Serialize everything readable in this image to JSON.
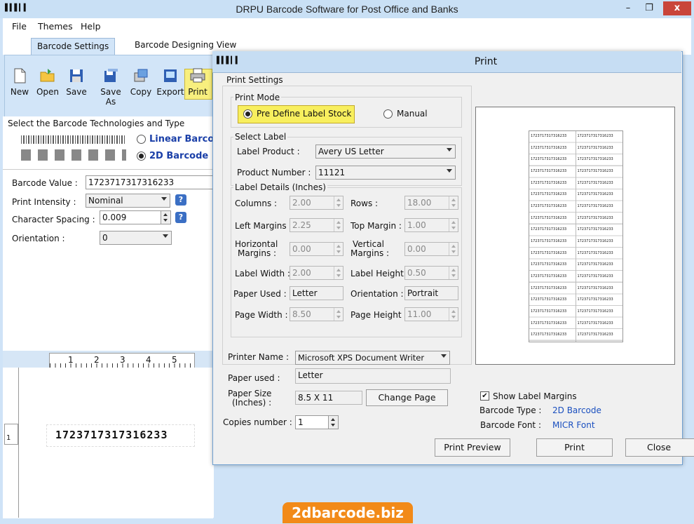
{
  "window": {
    "title": "DRPU Barcode Software for Post Office and Banks",
    "minimize": "–",
    "maximize": "❐",
    "close": "x"
  },
  "menu": [
    "File",
    "Themes",
    "Help"
  ],
  "tabs": [
    "Barcode Settings",
    "Barcode Designing View"
  ],
  "toolbar": {
    "new": "New",
    "open": "Open",
    "save": "Save",
    "save_as": "Save As",
    "copy": "Copy",
    "export": "Export",
    "print": "Print"
  },
  "left": {
    "tech_label": "Select the Barcode Technologies and Type",
    "linear": "Linear Barcod",
    "twod": "2D Barcode",
    "barcode_value_label": "Barcode Value :",
    "barcode_value": "1723717317316233",
    "print_intensity_label": "Print Intensity :",
    "print_intensity": "Nominal",
    "char_spacing_label": "Character Spacing :",
    "char_spacing": "0.009",
    "orientation_label": "Orientation :",
    "orientation": "0",
    "help": "?",
    "preview_text": "1723717317316233",
    "ruler_marks": [
      "1",
      "2",
      "3",
      "4",
      "5"
    ],
    "left_ruler_mark": "1"
  },
  "dialog": {
    "title": "Print",
    "print_settings": "Print Settings",
    "print_mode": "Print Mode",
    "predefine": "Pre Define Label Stock",
    "manual": "Manual",
    "select_label": "Select Label",
    "label_product_label": "Label Product :",
    "label_product": "Avery US Letter",
    "product_number_label": "Product Number :",
    "product_number": "11121",
    "label_details": "Label Details (Inches)",
    "columns_label": "Columns :",
    "columns": "2.00",
    "rows_label": "Rows :",
    "rows": "18.00",
    "left_margins_label": "Left Margins :",
    "left_margins": "2.25",
    "top_margin_label": "Top Margin :",
    "top_margin": "1.00",
    "h_margins_label1": "Horizontal",
    "h_margins_label2": "Margins :",
    "h_margins": "0.00",
    "v_margins_label1": "Vertical",
    "v_margins_label2": "Margins :",
    "v_margins": "0.00",
    "label_width_label": "Label Width :",
    "label_width": "2.00",
    "label_height_label": "Label Height :",
    "label_height": "0.50",
    "paper_used_label": "Paper Used :",
    "paper_used": "Letter",
    "orientation_label": "Orientation :",
    "orientation": "Portrait",
    "page_width_label": "Page Width :",
    "page_width": "8.50",
    "page_height_label": "Page Height :",
    "page_height": "11.00",
    "printer_name_label": "Printer Name :",
    "printer_name": "Microsoft XPS Document Writer",
    "paper_used2_label": "Paper used :",
    "paper_used2": "Letter",
    "paper_size_label1": "Paper Size",
    "paper_size_label2": "(Inches) :",
    "paper_size": "8.5 X 11",
    "change_page": "Change Page",
    "copies_label": "Copies number :",
    "copies": "1",
    "show_margins": "Show Label Margins",
    "barcode_type_label": "Barcode Type :",
    "barcode_type": "2D Barcode",
    "barcode_font_label": "Barcode Font :",
    "barcode_font": "MICR Font",
    "print_preview": "Print Preview",
    "print": "Print",
    "close": "Close",
    "sheet_label_text": "1723717317316233"
  },
  "watermark": "2dbarcode.biz"
}
